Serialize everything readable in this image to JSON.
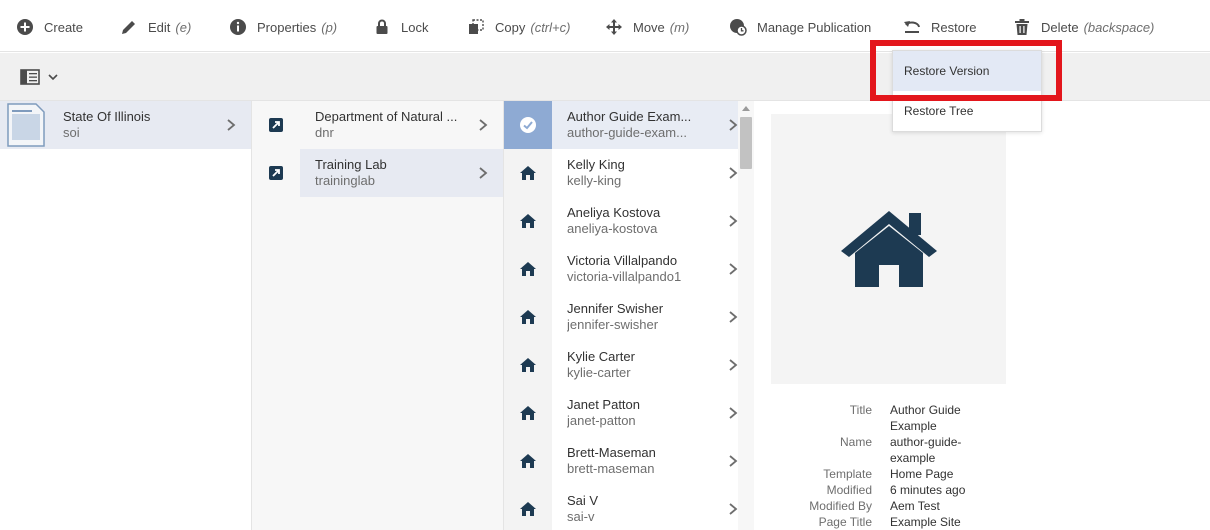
{
  "toolbar": {
    "create": {
      "label": "Create",
      "icon": "plus-circle-icon"
    },
    "edit": {
      "label": "Edit",
      "shortcut": "(e)",
      "icon": "pencil-icon"
    },
    "properties": {
      "label": "Properties",
      "shortcut": "(p)",
      "icon": "info-icon"
    },
    "lock": {
      "label": "Lock",
      "icon": "lock-icon"
    },
    "copy": {
      "label": "Copy",
      "shortcut": "(ctrl+c)",
      "icon": "copy-icon"
    },
    "move": {
      "label": "Move",
      "shortcut": "(m)",
      "icon": "move-icon"
    },
    "manage_publication": {
      "label": "Manage Publication",
      "icon": "globe-clock-icon"
    },
    "restore": {
      "label": "Restore",
      "icon": "undo-icon"
    },
    "delete": {
      "label": "Delete",
      "shortcut": "(backspace)",
      "icon": "trash-icon"
    }
  },
  "restore_menu": {
    "items": [
      {
        "label": "Restore Version",
        "active": true
      },
      {
        "label": "Restore Tree",
        "active": false
      }
    ]
  },
  "colors": {
    "highlight": "#e3161c",
    "icon_dark": "#1d3a52",
    "selected_row": "#e7eaf2",
    "selected_thumb": "#8eaad3"
  },
  "column1": {
    "items": [
      {
        "title": "State Of Illinois",
        "name": "soi",
        "icon": "page-thumbnail-icon"
      }
    ]
  },
  "column2": {
    "items": [
      {
        "title": "Department of Natural ...",
        "name": "dnr",
        "icon": "external-link-icon"
      },
      {
        "title": "Training Lab",
        "name": "traininglab",
        "icon": "external-link-icon"
      }
    ]
  },
  "column3": {
    "items": [
      {
        "title": "Author Guide Exam...",
        "name": "author-guide-exam...",
        "icon": "check-circle-icon"
      },
      {
        "title": "Kelly King",
        "name": "kelly-king",
        "icon": "home-icon"
      },
      {
        "title": "Aneliya Kostova",
        "name": "aneliya-kostova",
        "icon": "home-icon"
      },
      {
        "title": "Victoria Villalpando",
        "name": "victoria-villalpando1",
        "icon": "home-icon"
      },
      {
        "title": "Jennifer Swisher",
        "name": "jennifer-swisher",
        "icon": "home-icon"
      },
      {
        "title": "Kylie Carter",
        "name": "kylie-carter",
        "icon": "home-icon"
      },
      {
        "title": "Janet Patton",
        "name": "janet-patton",
        "icon": "home-icon"
      },
      {
        "title": "Brett-Maseman",
        "name": "brett-maseman",
        "icon": "home-icon"
      },
      {
        "title": "Sai V",
        "name": "sai-v",
        "icon": "home-icon"
      }
    ]
  },
  "details": {
    "preview_icon": "home-icon",
    "rows": [
      {
        "key": "Title",
        "value": "Author Guide Example"
      },
      {
        "key": "Name",
        "value": "author-guide-example"
      },
      {
        "key": "Template",
        "value": "Home Page"
      },
      {
        "key": "Modified",
        "value": "6 minutes ago"
      },
      {
        "key": "Modified By",
        "value": "Aem Test"
      },
      {
        "key": "Page Title",
        "value": "Example Site"
      }
    ]
  }
}
